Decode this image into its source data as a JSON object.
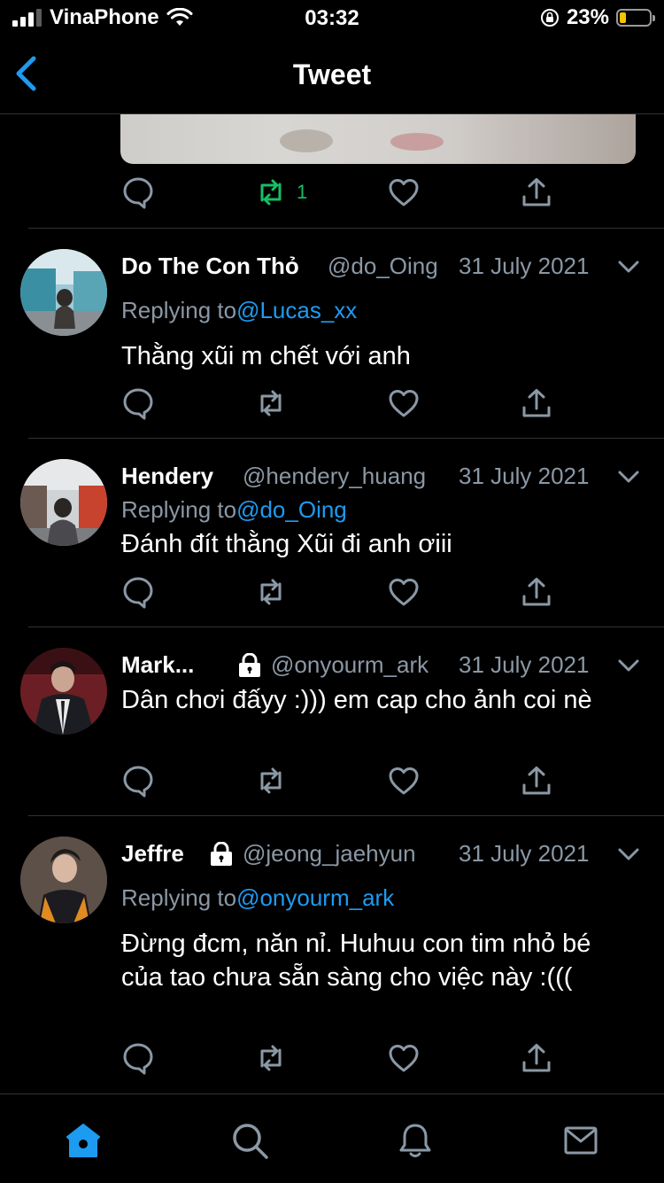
{
  "status_bar": {
    "carrier": "VinaPhone",
    "time": "03:32",
    "battery_percent": "23%",
    "battery_level": 0.23
  },
  "nav": {
    "title": "Tweet"
  },
  "top_tweet": {
    "retweet_count": "1"
  },
  "replies": [
    {
      "name": "Do The Con Thỏ",
      "handle": "@do_Oing",
      "date": "31 July 2021",
      "replying_prefix": "Replying to",
      "replying_to": "@Lucas_xx",
      "text": "Thằng xũi m chết với anh",
      "protected": false
    },
    {
      "name": "Hendery",
      "handle": "@hendery_huang",
      "date": "31 July 2021",
      "replying_prefix": "Replying to",
      "replying_to": "@do_Oing",
      "text": "Đánh đít thằng Xũi đi anh ơiii",
      "protected": false
    },
    {
      "name": "Mark...",
      "handle": "@onyourm_ark",
      "date": "31 July 2021",
      "text": "Dân chơi đấyy :))) em cap cho ảnh coi nè",
      "protected": true
    },
    {
      "name": "Jeffre",
      "handle": "@jeong_jaehyun",
      "date": "31 July 2021",
      "replying_prefix": "Replying to",
      "replying_to": "@onyourm_ark",
      "text": "Đừng đcm, năn nỉ. Huhuu con tim nhỏ bé của tao chưa sẵn sàng cho việc này :(((",
      "protected": true
    }
  ],
  "icons": {
    "reply": "speech-bubble-icon",
    "retweet": "retweet-icon",
    "like": "heart-icon",
    "share": "share-icon",
    "more": "chevron-down-icon",
    "tabs": [
      "home-icon",
      "search-icon",
      "notifications-icon",
      "messages-icon"
    ]
  },
  "colors": {
    "accent": "#1d9bf0",
    "retweet_active": "#17bf63",
    "secondary_text": "#8b98a5",
    "divider": "#2f3336"
  }
}
